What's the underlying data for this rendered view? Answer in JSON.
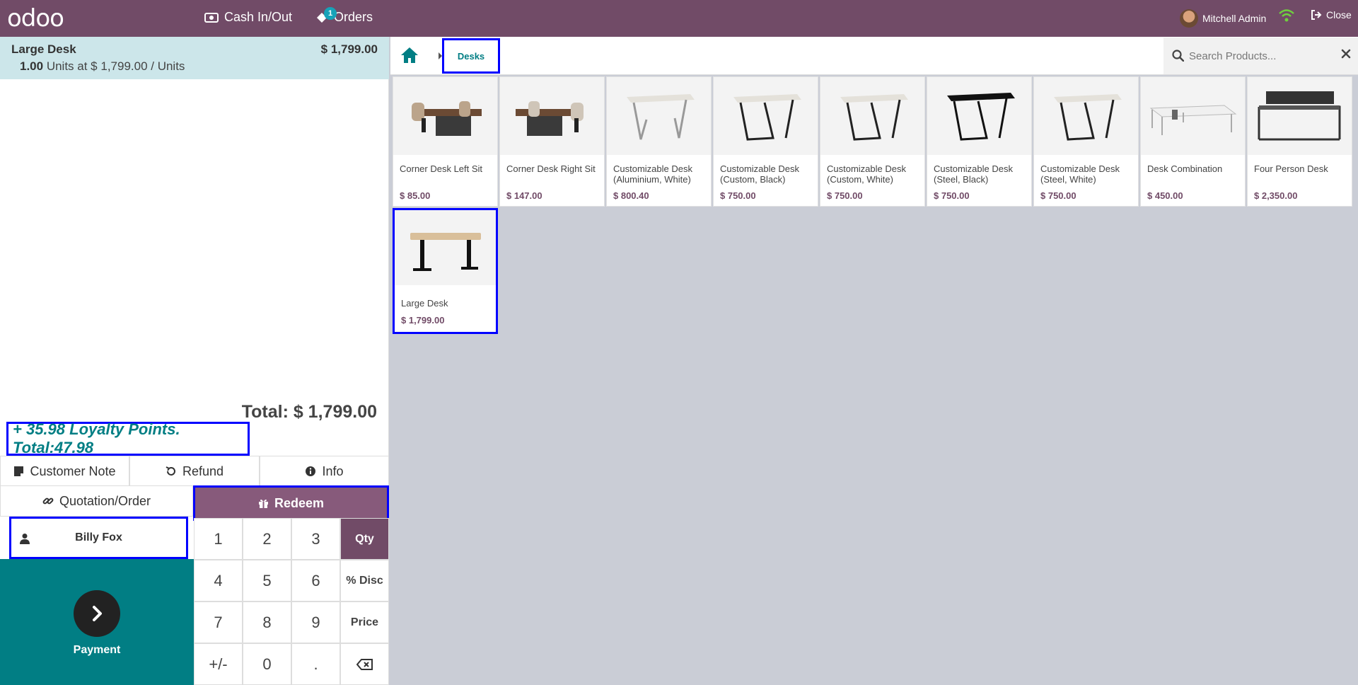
{
  "topbar": {
    "logo": "odoo",
    "cash_label": "Cash In/Out",
    "orders_label": "Orders",
    "orders_badge": "1",
    "user_name": "Mitchell Admin",
    "close_label": "Close"
  },
  "order": {
    "line": {
      "name": "Large Desk",
      "price": "$ 1,799.00",
      "qty": "1.00",
      "unit_info": "Units at $ 1,799.00 / Units"
    },
    "total": "Total: $ 1,799.00",
    "loyalty": "+ 35.98 Loyalty Points. Total:47.98"
  },
  "controls": {
    "customer_note": "Customer Note",
    "refund": "Refund",
    "info": "Info",
    "quotation": "Quotation/Order",
    "redeem": "Redeem",
    "customer": "Billy Fox",
    "payment": "Payment"
  },
  "numpad": {
    "k1": "1",
    "k2": "2",
    "k3": "3",
    "qty": "Qty",
    "k4": "4",
    "k5": "5",
    "k6": "6",
    "disc": "% Disc",
    "k7": "7",
    "k8": "8",
    "k9": "9",
    "price": "Price",
    "sign": "+/-",
    "k0": "0",
    "dot": "."
  },
  "breadcrumb": {
    "category": "Desks"
  },
  "search": {
    "placeholder": "Search Products..."
  },
  "products": [
    {
      "name": "Corner Desk Left Sit",
      "price": "$ 85.00"
    },
    {
      "name": "Corner Desk Right Sit",
      "price": "$ 147.00"
    },
    {
      "name": "Customizable Desk (Aluminium, White)",
      "price": "$ 800.40"
    },
    {
      "name": "Customizable Desk (Custom, Black)",
      "price": "$ 750.00"
    },
    {
      "name": "Customizable Desk (Custom, White)",
      "price": "$ 750.00"
    },
    {
      "name": "Customizable Desk (Steel, Black)",
      "price": "$ 750.00"
    },
    {
      "name": "Customizable Desk (Steel, White)",
      "price": "$ 750.00"
    },
    {
      "name": "Desk Combination",
      "price": "$ 450.00"
    },
    {
      "name": "Four Person Desk",
      "price": "$ 2,350.00"
    },
    {
      "name": "Large Desk",
      "price": "$ 1,799.00"
    }
  ],
  "colors": {
    "brand": "#714b67",
    "accent": "#017e84",
    "highlight": "#0000ff"
  }
}
